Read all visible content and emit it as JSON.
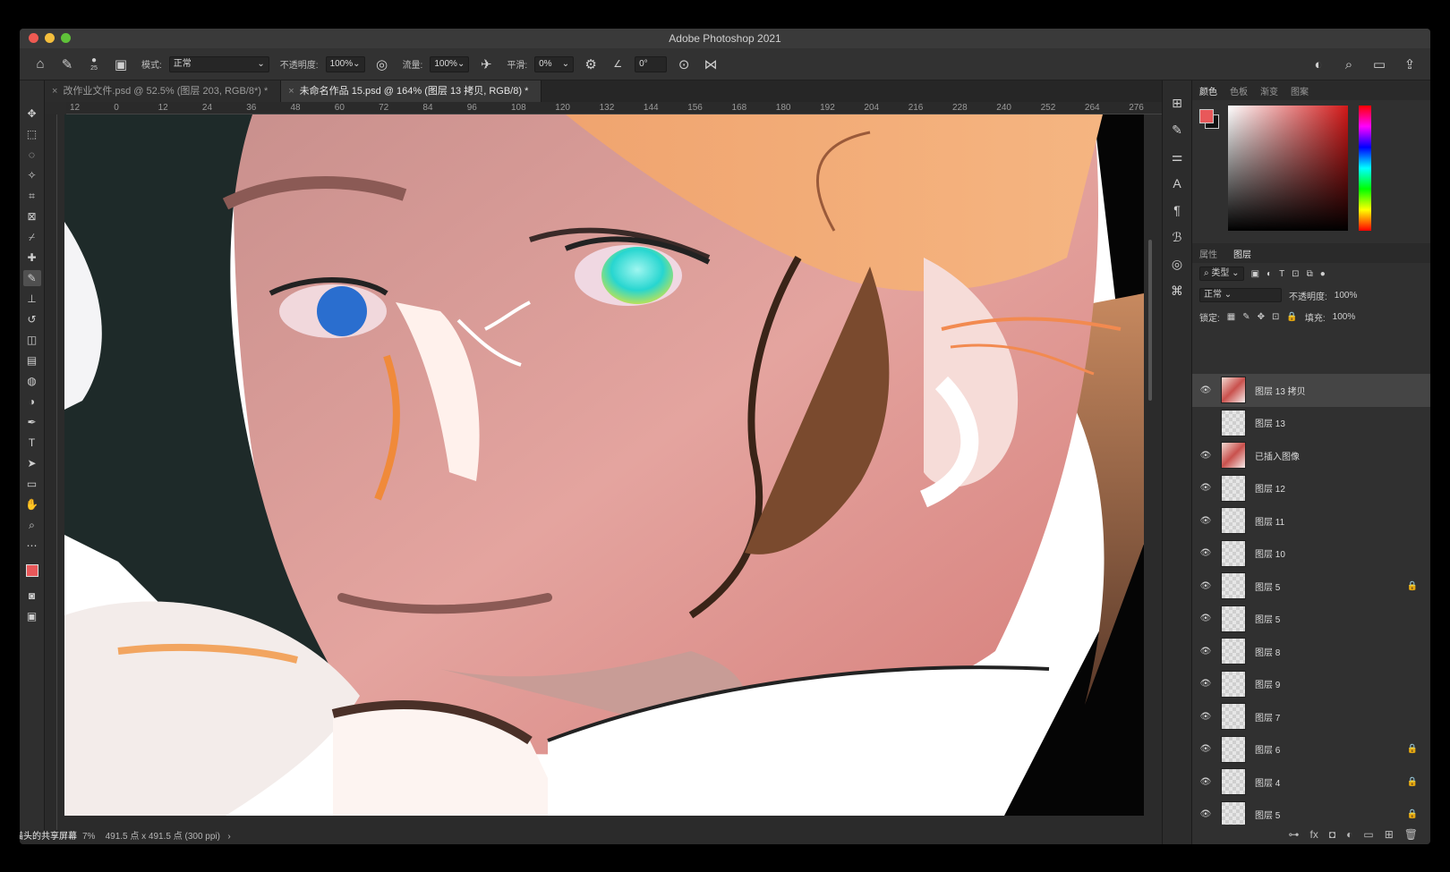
{
  "window": {
    "title": "Adobe Photoshop 2021"
  },
  "options": {
    "brush_size": "25",
    "mode_label": "模式:",
    "mode_value": "正常",
    "opacity_label": "不透明度:",
    "opacity_value": "100%",
    "flow_label": "流量:",
    "flow_value": "100%",
    "smoothing_label": "平滑:",
    "smoothing_value": "0%",
    "angle_value": "0°"
  },
  "tabs": [
    {
      "label": "改作业文件.psd @ 52.5% (图层 203, RGB/8*) *"
    },
    {
      "label": "未命名作品 15.psd @ 164% (图层 13 拷贝, RGB/8) *"
    }
  ],
  "ruler": {
    "ticks": [
      "12",
      "0",
      "12",
      "24",
      "36",
      "48",
      "60",
      "72",
      "84",
      "96",
      "108",
      "120",
      "132",
      "144",
      "156",
      "168",
      "180",
      "192",
      "204",
      "216",
      "228",
      "240",
      "252",
      "264",
      "276"
    ]
  },
  "status": {
    "zoom": "7%",
    "dimensions": "491.5 点 x 491.5 点 (300 ppi)",
    "share_note": "猫猫头的共享屏幕"
  },
  "color_panel": {
    "tabs": [
      "颜色",
      "色板",
      "渐变",
      "图案"
    ],
    "fg_color": "#e8585a",
    "bg_color": "#111111"
  },
  "layers_panel": {
    "tabs": [
      "属性",
      "图层"
    ],
    "filter_label": "类型",
    "blend_mode": "正常",
    "opacity_label": "不透明度:",
    "opacity_value": "100%",
    "lock_label": "锁定:",
    "fill_label": "填充:",
    "fill_value": "100%",
    "layers": [
      {
        "name": "图层 13 拷贝",
        "visible": true,
        "selected": true,
        "locked": false
      },
      {
        "name": "图层 13",
        "visible": false,
        "selected": false,
        "locked": false
      },
      {
        "name": "已插入图像",
        "visible": true,
        "selected": false,
        "locked": false
      },
      {
        "name": "图层 12",
        "visible": true,
        "selected": false,
        "locked": false
      },
      {
        "name": "图层 11",
        "visible": true,
        "selected": false,
        "locked": false
      },
      {
        "name": "图层 10",
        "visible": true,
        "selected": false,
        "locked": false
      },
      {
        "name": "图层 5",
        "visible": true,
        "selected": false,
        "locked": true
      },
      {
        "name": "图层 5",
        "visible": true,
        "selected": false,
        "locked": false
      },
      {
        "name": "图层 8",
        "visible": true,
        "selected": false,
        "locked": false
      },
      {
        "name": "图层 9",
        "visible": true,
        "selected": false,
        "locked": false
      },
      {
        "name": "图层 7",
        "visible": true,
        "selected": false,
        "locked": false
      },
      {
        "name": "图层 6",
        "visible": true,
        "selected": false,
        "locked": true
      },
      {
        "name": "图层 4",
        "visible": true,
        "selected": false,
        "locked": true
      },
      {
        "name": "图层 5",
        "visible": true,
        "selected": false,
        "locked": true
      }
    ]
  }
}
